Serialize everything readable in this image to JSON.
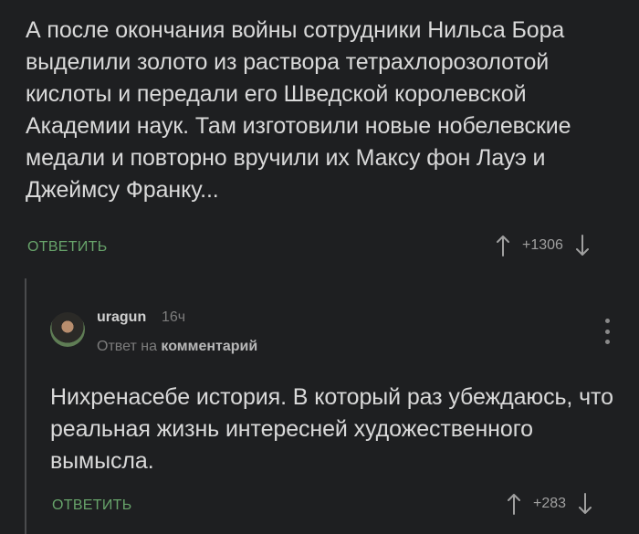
{
  "comment": {
    "text": "А после окончания войны сотрудники Нильса Бора выделили золото из раствора тетрахлорозолотой кислоты и передали его Шведской королевской Академии наук. Там изготовили новые нобелевские медали и повторно вручили их Максу фон Лауэ и Джеймсу Франку...",
    "reply_label": "ОТВЕТИТЬ",
    "score": "+1306",
    "upvote_icon": "arrow-up-icon",
    "downvote_icon": "arrow-down-icon"
  },
  "reply": {
    "username": "uragun",
    "time": "16ч",
    "reply_prefix": "Ответ на",
    "reply_link": "комментарий",
    "text": "Нихренасебе история. В который раз убеждаюсь, что реальная жизнь интересней художественного вымысла.",
    "reply_label": "ОТВЕТИТЬ",
    "score": "+283",
    "more_icon": "more-vertical-icon"
  },
  "colors": {
    "background": "#1e1f21",
    "text": "#d9d9d9",
    "accent_green": "#67a36a",
    "muted": "#7d7d7d"
  }
}
